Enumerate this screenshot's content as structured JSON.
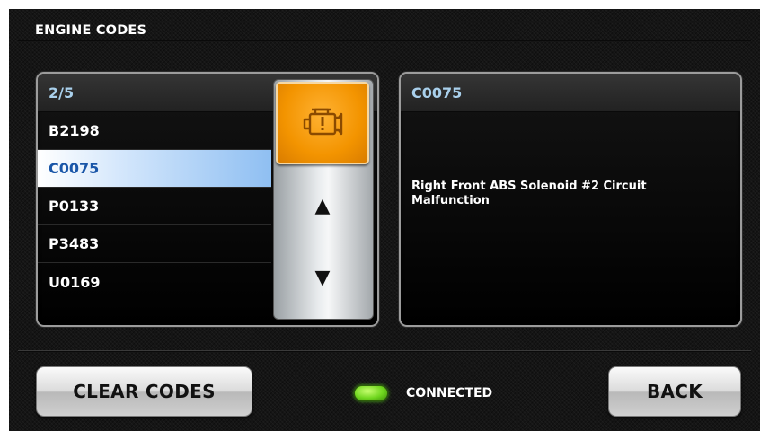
{
  "screen": {
    "title": "ENGINE CODES"
  },
  "code_list": {
    "page_indicator": "2/5",
    "items": [
      {
        "label": "B2198",
        "selected": false
      },
      {
        "label": "C0075",
        "selected": true
      },
      {
        "label": "P0133",
        "selected": false
      },
      {
        "label": "P3483",
        "selected": false
      },
      {
        "label": "U0169",
        "selected": false
      }
    ]
  },
  "scroll_controls": {
    "engine_icon": "check-engine-icon",
    "up_icon": "▲",
    "down_icon": "▼"
  },
  "detail": {
    "code": "C0075",
    "description": "Right Front ABS Solenoid #2 Circuit Malfunction"
  },
  "footer": {
    "clear_label": "CLEAR CODES",
    "status_label": "CONNECTED",
    "status_color": "#6fd61e",
    "back_label": "BACK"
  },
  "colors": {
    "accent_text": "#a9d0ec",
    "engine_button": "#f39400",
    "selected_text": "#1a56a8"
  }
}
